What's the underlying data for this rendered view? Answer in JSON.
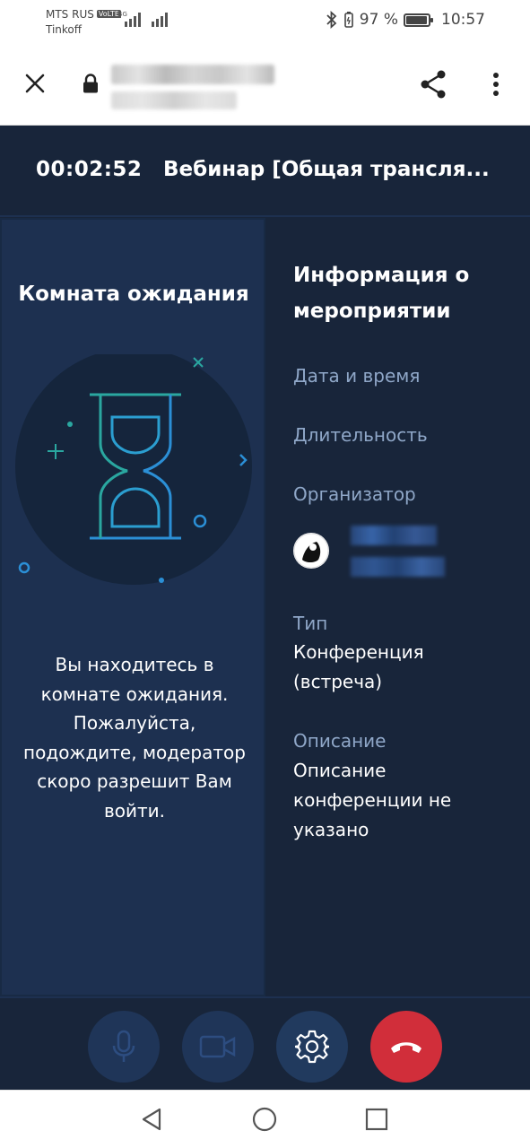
{
  "status_bar": {
    "carrier_primary": "MTS RUS",
    "volte_badge": "VoLTE",
    "carrier_secondary": "Tinkoff",
    "network_type": "4G",
    "battery_percent": "97 %",
    "battery_level": 0.97,
    "time": "10:57"
  },
  "browser": {
    "icons": {
      "close": "close-icon",
      "lock": "lock-icon",
      "share": "share-icon",
      "menu": "more-vert-icon"
    }
  },
  "header": {
    "timer": "00:02:52",
    "title": "Вебинар [Общая трансля..."
  },
  "waiting_room": {
    "title": "Комната ожидания",
    "message": "Вы находитесь в комнате ожидания. Пожалуйста, подождите, модератор скоро разрешит Вам войти."
  },
  "event_info": {
    "title": "Информация о мероприятии",
    "date_label": "Дата и время",
    "duration_label": "Длительность",
    "organizer_label": "Организатор",
    "type_label": "Тип",
    "type_value": "Конференция (встреча)",
    "description_label": "Описание",
    "description_value": "Описание конференции не указано"
  },
  "controls": {
    "icons": [
      "microphone-icon",
      "camera-icon",
      "gear-icon",
      "hang-up-icon"
    ],
    "colors": {
      "dim": "#1f3558",
      "settings": "#213a5e",
      "hang_up": "#d12e3a"
    }
  },
  "nav": {
    "icons": [
      "back-icon",
      "home-icon",
      "recents-icon"
    ]
  },
  "colors": {
    "app_background": "#18253a",
    "panel_background": "#1d3050",
    "label_color": "#8fa7c8",
    "accent_teal": "#2aa7a0",
    "accent_blue": "#2b8fd6"
  }
}
